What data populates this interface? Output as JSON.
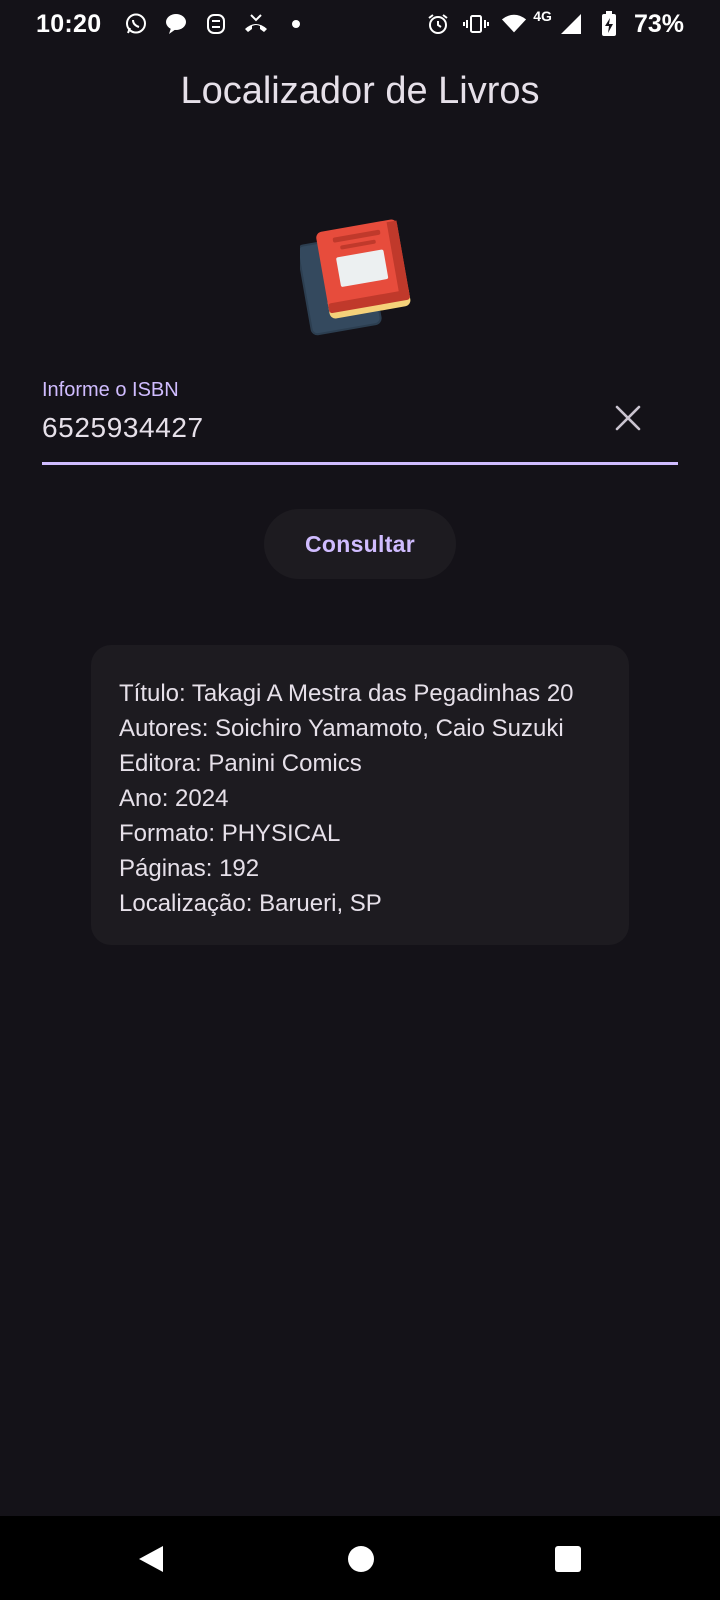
{
  "status_bar": {
    "time": "10:20",
    "left_icons": [
      "whatsapp-icon",
      "chat-bubble-icon",
      "app-notification-icon",
      "missed-call-icon",
      "more-notifications-dot"
    ],
    "right_icons": [
      "alarm-icon",
      "vibrate-icon",
      "wifi-icon",
      "cellular-signal-icon",
      "battery-charging-icon"
    ],
    "network_type": "4G",
    "battery_percent": "73%"
  },
  "app": {
    "title": "Localizador de Livros",
    "logo_icon": "books-icon"
  },
  "isbn_field": {
    "label": "Informe o ISBN",
    "value": "6525934427",
    "clear_icon": "close-icon",
    "accent_color": "#d0bcff"
  },
  "search_button": {
    "label": "Consultar"
  },
  "result": {
    "lines": [
      "Título: Takagi A Mestra das Pegadinhas 20",
      "Autores: Soichiro Yamamoto, Caio Suzuki",
      "Editora: Panini Comics",
      "Ano: 2024",
      "Formato: PHYSICAL",
      "Páginas: 192",
      "Localização: Barueri, SP"
    ]
  },
  "nav_bar": {
    "buttons": [
      "back-icon",
      "home-icon",
      "recents-icon"
    ]
  },
  "colors": {
    "background": "#141218",
    "surface": "#1d1b20",
    "primary": "#d0bcff",
    "on_surface": "#e6e0e9"
  }
}
